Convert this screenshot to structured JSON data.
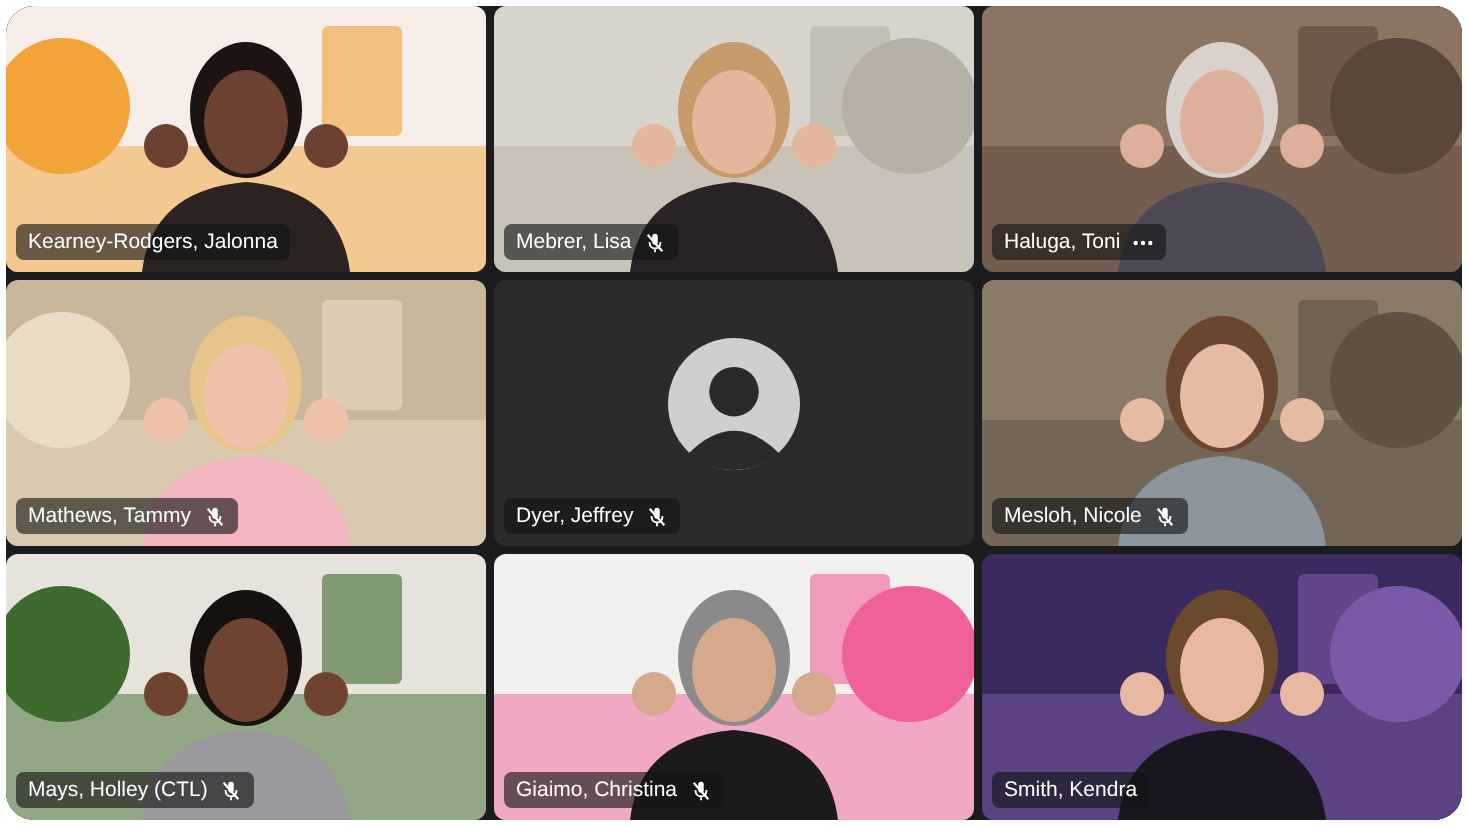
{
  "participants": [
    {
      "name": "Kearney-Rodgers, Jalonna",
      "kind": "video",
      "muted": false,
      "menu": false
    },
    {
      "name": "Mebrer, Lisa",
      "kind": "video",
      "muted": true,
      "menu": false
    },
    {
      "name": "Haluga, Toni",
      "kind": "video",
      "muted": false,
      "menu": true
    },
    {
      "name": "Mathews, Tammy",
      "kind": "video",
      "muted": true,
      "menu": false
    },
    {
      "name": "Dyer, Jeffrey",
      "kind": "avatar",
      "muted": true,
      "menu": false
    },
    {
      "name": "Mesloh, Nicole",
      "kind": "video",
      "muted": true,
      "menu": false
    },
    {
      "name": "Mays, Holley (CTL)",
      "kind": "video",
      "muted": true,
      "menu": false
    },
    {
      "name": "Giaimo, Christina",
      "kind": "video",
      "muted": true,
      "menu": false
    },
    {
      "name": "Smith, Kendra",
      "kind": "video",
      "muted": false,
      "menu": false
    }
  ]
}
